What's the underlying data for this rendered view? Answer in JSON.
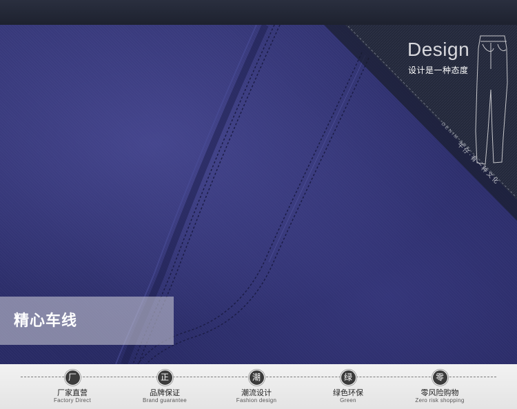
{
  "brand_tag": {
    "title": "Design",
    "subtitle": "设计是一种态度",
    "ribbon_text": "DENIM ART",
    "ribbon_zh": "牛仔·有一种文化"
  },
  "caption": {
    "text": "精心车线"
  },
  "guarantees": [
    {
      "icon_char": "厂",
      "label": "厂家直营",
      "label_en": "Factory Direct"
    },
    {
      "icon_char": "正",
      "label": "品牌保证",
      "label_en": "Brand guarantee"
    },
    {
      "icon_char": "潮",
      "label": "潮流设计",
      "label_en": "Fashion design"
    },
    {
      "icon_char": "绿",
      "label": "绿色环保",
      "label_en": "Green"
    },
    {
      "icon_char": "零",
      "label": "零风险购物",
      "label_en": "Zero risk shopping"
    }
  ],
  "colors": {
    "fabric": "#2c2e6c",
    "band": "#1c202d",
    "bar": "#ececec",
    "badge": "#3b3b3b"
  }
}
